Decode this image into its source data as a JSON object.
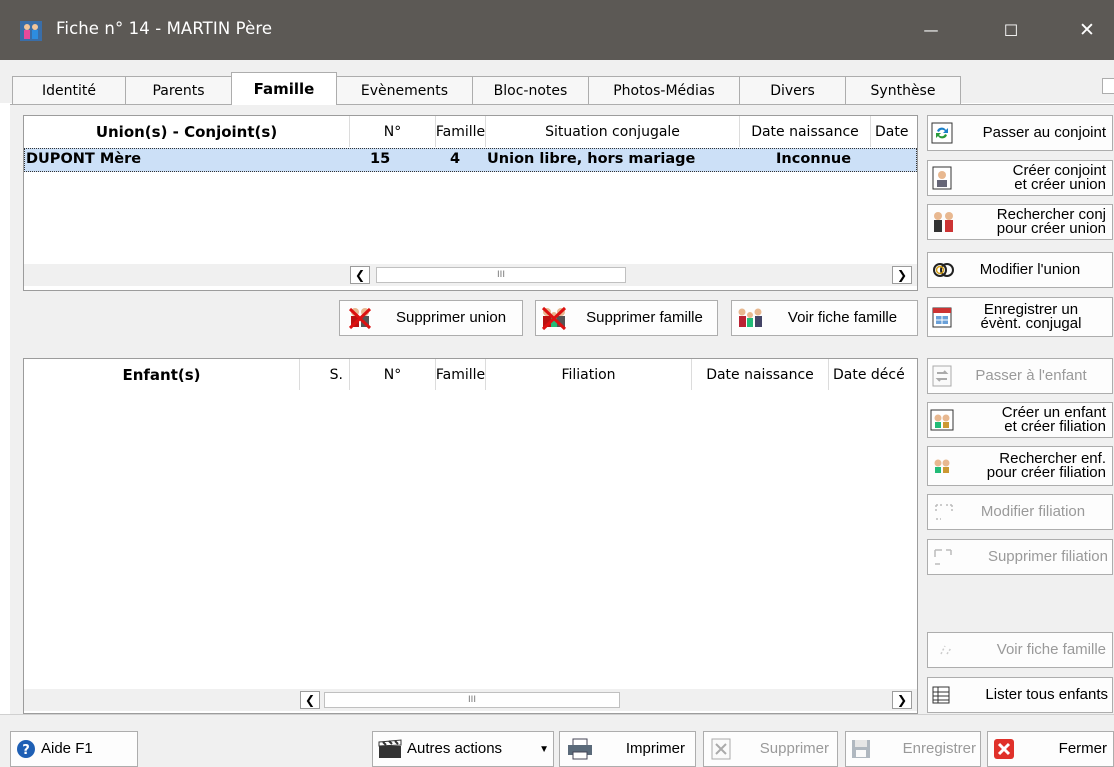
{
  "window": {
    "title": "Fiche n° 14  -  MARTIN Père",
    "minimize_glyph": "—",
    "maximize_glyph": "☐",
    "close_glyph": "✕"
  },
  "tabs": [
    "Identité",
    "Parents",
    "Famille",
    "Evènements",
    "Bloc-notes",
    "Photos-Médias",
    "Divers",
    "Synthèse"
  ],
  "active_tab": "Famille",
  "unions": {
    "columns": [
      "Union(s) - Conjoint(s)",
      "N°",
      "Famille",
      "Situation conjugale",
      "Date naissance",
      "Date"
    ],
    "rows": [
      {
        "conjoint": "DUPONT Mère",
        "numero": "15",
        "famille": "4",
        "situation": "Union libre, hors mariage",
        "date_naissance": "Inconnue"
      }
    ],
    "scroll_thumb": "III"
  },
  "union_actions": {
    "supprimer_union": "Supprimer union",
    "supprimer_famille": "Supprimer famille",
    "voir_fiche_famille": "Voir fiche famille"
  },
  "enfants": {
    "columns": [
      "Enfant(s)",
      "S.",
      "N°",
      "Famille",
      "Filiation",
      "Date naissance",
      "Date décé"
    ],
    "rows": [],
    "scroll_thumb": "III"
  },
  "side_buttons": {
    "passer_conjoint": "Passer au conjoint",
    "creer_conjoint": [
      "Créer conjoint",
      "et créer union"
    ],
    "rechercher_conj": [
      "Rechercher conj",
      "pour créer union"
    ],
    "modifier_union": "Modifier l'union",
    "enregistrer_event": [
      "Enregistrer un",
      "évènt. conjugal"
    ],
    "passer_enfant": "Passer à l'enfant",
    "creer_enfant": [
      "Créer un enfant",
      "et créer filiation"
    ],
    "rechercher_enf": [
      "Rechercher enf.",
      "pour créer filiation"
    ],
    "modifier_filiation": "Modifier filiation",
    "supprimer_filiation": "Supprimer filiation",
    "voir_fiche_famille": "Voir fiche famille",
    "lister_enfants": "Lister tous enfants"
  },
  "bottom": {
    "aide": "Aide  F1",
    "autres_actions": "Autres actions",
    "imprimer": "Imprimer",
    "supprimer": "Supprimer",
    "enregistrer": "Enregistrer",
    "fermer": "Fermer"
  },
  "colors": {
    "titlebar": "#5c5955",
    "selection": "#cce0f7",
    "window_bg": "#f0f0f0",
    "disabled_text": "#9a9a9a",
    "help_blue": "#1e5fb4",
    "close_red": "#e0312a"
  }
}
